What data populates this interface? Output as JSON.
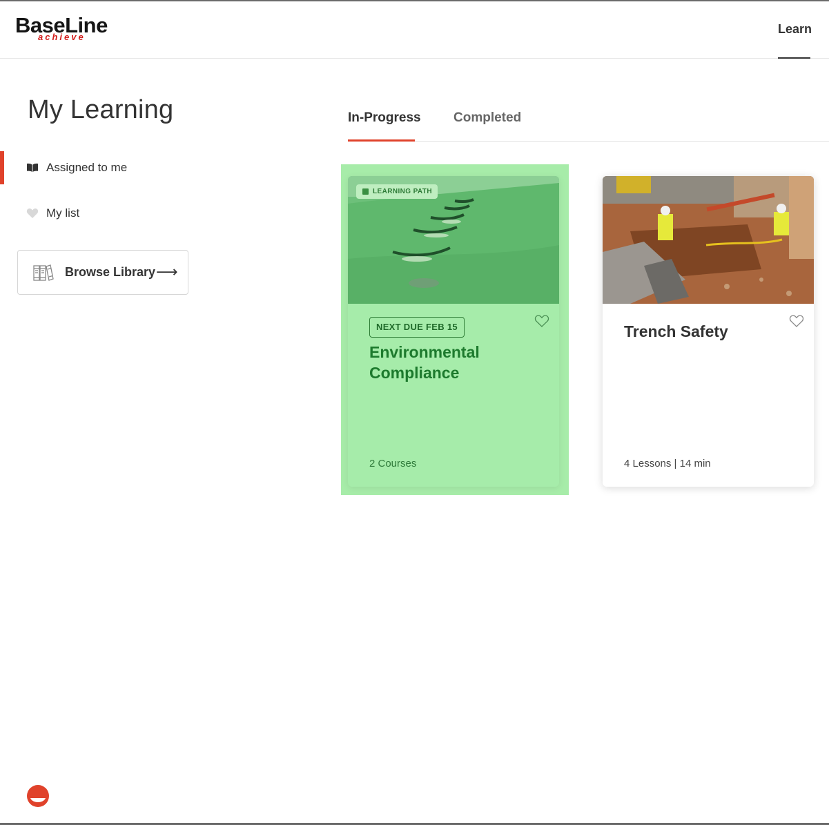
{
  "header": {
    "logo_main": "BaseLine",
    "logo_sub": "achieve",
    "nav_learn": "Learn"
  },
  "sidebar": {
    "title": "My Learning",
    "items": [
      {
        "label": "Assigned to me",
        "icon": "book-open-icon",
        "active": true
      },
      {
        "label": "My list",
        "icon": "heart-icon",
        "active": false
      }
    ],
    "browse_button": {
      "label": "Browse Library",
      "arrow": "⟶",
      "icon": "library-books-icon"
    }
  },
  "tabs": [
    {
      "label": "In-Progress",
      "active": true
    },
    {
      "label": "Completed",
      "active": false
    }
  ],
  "cards": [
    {
      "type_badge": "LEARNING PATH",
      "due": "NEXT DUE FEB 15",
      "title": "Environmental Compliance",
      "meta": "2 Courses",
      "image": "grass-slope-silt-fence"
    },
    {
      "title": "Trench Safety",
      "meta": "4 Lessons | 14 min",
      "image": "trench-excavation-workers"
    }
  ],
  "colors": {
    "accent": "#e0422b",
    "highlight_green": "#a7eca9",
    "title_green": "#1d7a2d",
    "logo_red": "#d3201f"
  }
}
